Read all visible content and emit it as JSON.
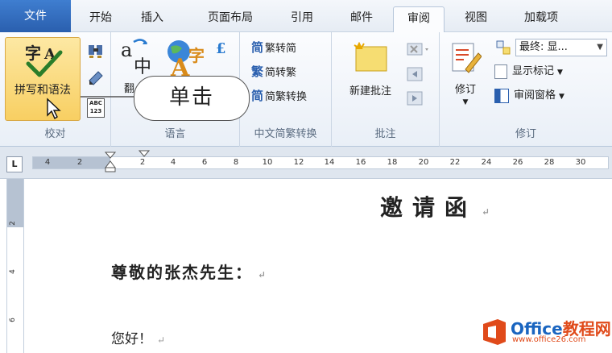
{
  "tabs": [
    "文件",
    "开始",
    "插入",
    "页面布局",
    "引用",
    "邮件",
    "审阅",
    "视图",
    "加载项"
  ],
  "ribbon": {
    "proofing": {
      "label": "校对",
      "spell_button": "拼写和语法",
      "abc_badge": "ABC\n123"
    },
    "language": {
      "label": "语言",
      "translate_partial": "翻"
    },
    "chinese_conversion": {
      "label": "中文简繁转换",
      "to_simplified": "繁转简",
      "to_traditional": "简转繁",
      "convert": "简繁转换",
      "icon_char_1": "简",
      "icon_char_2": "繁",
      "icon_char_3": "简"
    },
    "comments": {
      "label": "批注",
      "new_comment": "新建批注"
    },
    "tracking": {
      "label": "修订",
      "track_changes": "修订",
      "display_dropdown": "最终: 显...",
      "show_markup": "显示标记",
      "reviewing_pane": "审阅窗格"
    }
  },
  "callout": "单击",
  "ruler": {
    "corner": "L",
    "numbers": [
      "4",
      "2",
      "2",
      "4",
      "6",
      "8",
      "10",
      "12",
      "14",
      "16",
      "18",
      "20",
      "22",
      "24",
      "26",
      "28",
      "30"
    ],
    "vertical_numbers": [
      "2",
      "4",
      "6"
    ]
  },
  "document": {
    "title": "邀请函",
    "greeting": "尊敬的张杰先生：",
    "hello": "您好！",
    "paragraph_mark": "↵"
  },
  "watermark": {
    "brand_en": "Office",
    "brand_cn": "教程网",
    "url": "www.office26.com"
  },
  "colors": {
    "file_tab": "#2a5fae",
    "spell_highlight": "#f8cf62",
    "watermark_blue": "#1a65c0",
    "watermark_orange": "#e04a1a"
  }
}
